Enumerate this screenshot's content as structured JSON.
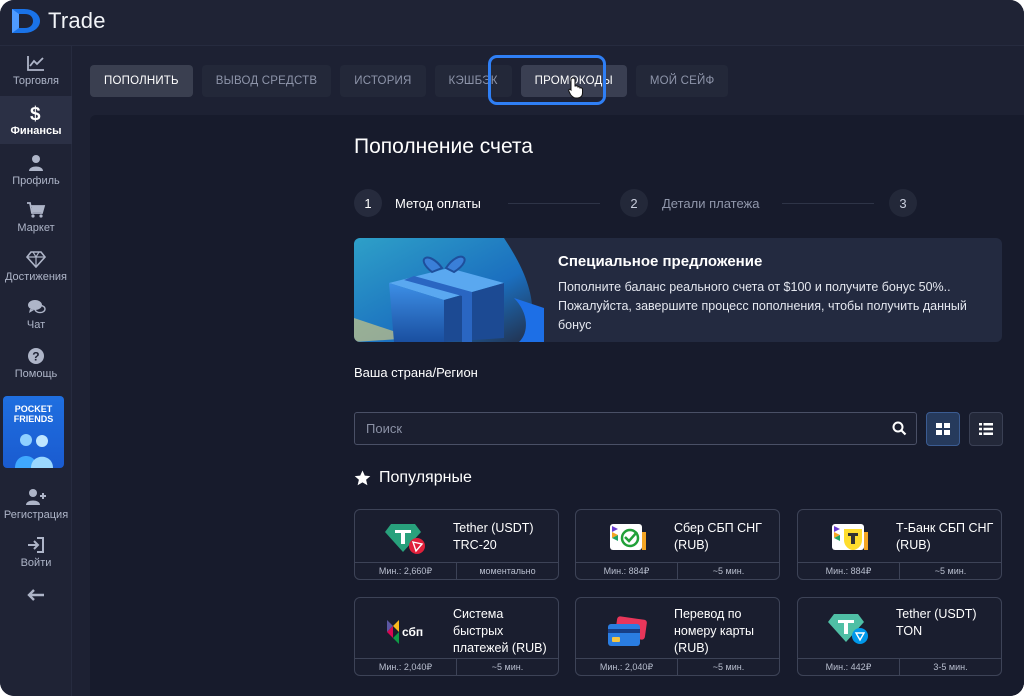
{
  "app": {
    "logo_text": "Trade"
  },
  "sidebar": {
    "items": [
      {
        "label": "Торговля",
        "icon": "chart-line-icon"
      },
      {
        "label": "Финансы",
        "icon": "dollar-icon"
      },
      {
        "label": "Профиль",
        "icon": "user-icon"
      },
      {
        "label": "Маркет",
        "icon": "cart-icon"
      },
      {
        "label": "Достижения",
        "icon": "diamond-icon"
      },
      {
        "label": "Чат",
        "icon": "chat-icon"
      },
      {
        "label": "Помощь",
        "icon": "help-icon"
      },
      {
        "label": "Регистрация",
        "icon": "add-user-icon"
      },
      {
        "label": "Войти",
        "icon": "sign-in-icon"
      }
    ],
    "pocket_friends": {
      "line1": "POCKET",
      "line2": "FRIENDS"
    }
  },
  "tabs": [
    "ПОПОЛНИТЬ",
    "ВЫВОД СРЕДСТВ",
    "ИСТОРИЯ",
    "КЭШБЭК",
    "ПРОМОКОДЫ",
    "МОЙ СЕЙФ"
  ],
  "page": {
    "title": "Пополнение счета",
    "steps": [
      {
        "num": "1",
        "label": "Метод оплаты"
      },
      {
        "num": "2",
        "label": "Детали платежа"
      },
      {
        "num": "3",
        "label": ""
      }
    ],
    "banner": {
      "title": "Специальное предложение",
      "text": "Пополните баланс реального счета от $100 и получите бонус 50%.. Пожалуйста, завершите процесс пополнения, чтобы получить данный бонус"
    },
    "region_label": "Ваша страна/Регион",
    "search": {
      "placeholder": "Поиск",
      "value": ""
    },
    "popular_label": "Популярные"
  },
  "methods": [
    {
      "name": "Tether (USDT) TRC-20",
      "min": "Мин.: 2,660₽",
      "time": "моментально",
      "icon": "tether-trc20-icon"
    },
    {
      "name": "Сбер СБП СНГ (RUB)",
      "min": "Мин.: 884₽",
      "time": "~5 мин.",
      "icon": "sber-sbp-icon"
    },
    {
      "name": "Т-Банк СБП СНГ (RUB)",
      "min": "Мин.: 884₽",
      "time": "~5 мин.",
      "icon": "tbank-sbp-icon"
    },
    {
      "name": "Система быстрых платежей (RUB)",
      "min": "Мин.: 2,040₽",
      "time": "~5 мин.",
      "icon": "sbp-icon"
    },
    {
      "name": "Перевод по номеру карты (RUB)",
      "min": "Мин.: 2,040₽",
      "time": "~5 мин.",
      "icon": "bank-card-icon"
    },
    {
      "name": "Tether (USDT) TON",
      "min": "Мин.: 442₽",
      "time": "3-5 мин.",
      "icon": "tether-ton-icon"
    }
  ],
  "colors": {
    "accent": "#2f7ff5",
    "background": "#1d2133",
    "panel": "#171b2c"
  }
}
